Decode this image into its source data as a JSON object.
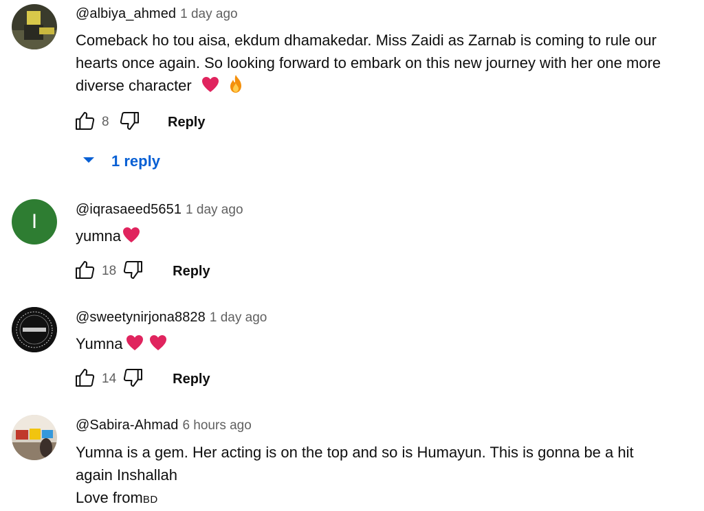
{
  "comments": [
    {
      "author": "@albiya_ahmed",
      "time": "1 day ago",
      "text_line1": "Comeback ho tou aisa, ekdum dhamakedar. Miss Zaidi as Zarnab is coming to rule our",
      "text_line2": "hearts once again. So looking forward to embark on this new journey with her one more",
      "text_line3": "diverse character",
      "likes": "8",
      "reply_label": "Reply",
      "replies_label": "1 reply"
    },
    {
      "author": "@iqrasaeed5651",
      "avatar_letter": "I",
      "avatar_color": "#2e7d32",
      "time": "1 day ago",
      "text": "yumna",
      "likes": "18",
      "reply_label": "Reply"
    },
    {
      "author": "@sweetynirjona8828",
      "time": "1 day ago",
      "text": "Yumna",
      "likes": "14",
      "reply_label": "Reply"
    },
    {
      "author": "@Sabira-Ahmad",
      "time": "6 hours ago",
      "text_line1": "Yumna is a gem. Her acting is on the top and so is Humayun. This is gonna be a hit",
      "text_line2": "again Inshallah",
      "text_line3": "Love from",
      "text_suffix": "BD"
    }
  ],
  "colors": {
    "link_blue": "#065fd4",
    "secondary_text": "#606060",
    "heart_red": "#e0245e"
  },
  "icons": [
    "thumb-up-icon",
    "thumb-down-icon",
    "chevron-down-icon",
    "heart-emoji-icon",
    "fire-emoji-icon"
  ]
}
